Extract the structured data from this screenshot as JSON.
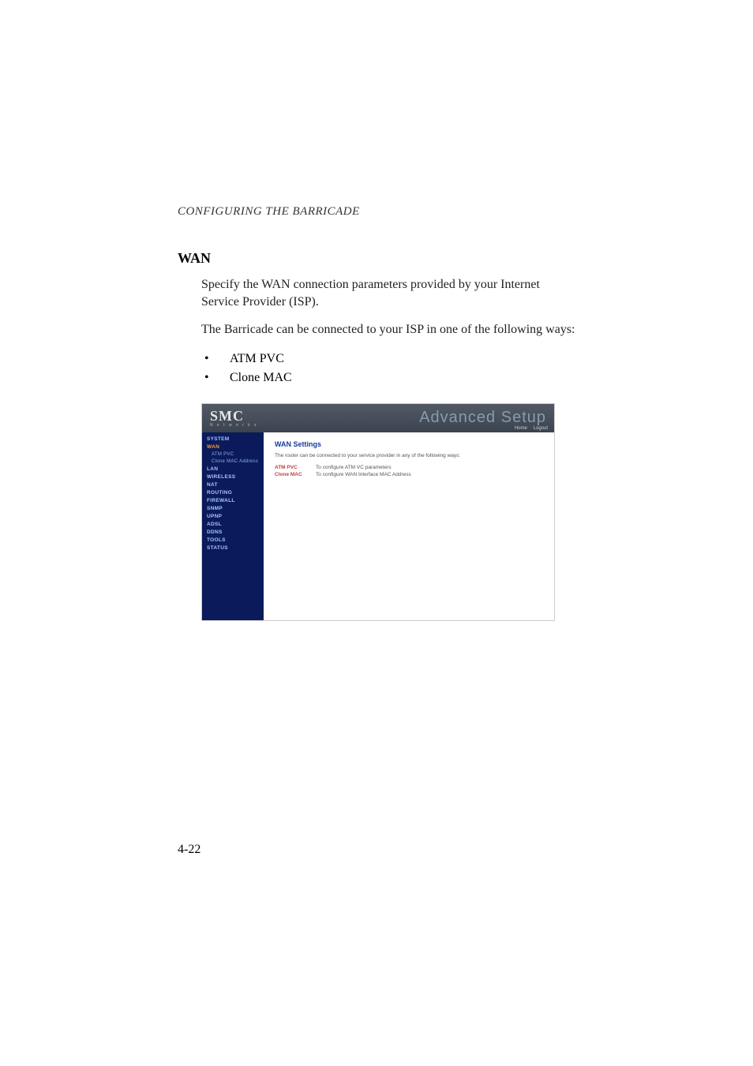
{
  "header": {
    "running": "CONFIGURING THE BARRICADE"
  },
  "section": {
    "title": "WAN",
    "para1": "Specify the WAN connection parameters provided by your Internet Service Provider (ISP).",
    "para2": "The Barricade can be connected to your ISP in one of the following ways:",
    "bullets": [
      "ATM PVC",
      "Clone MAC"
    ]
  },
  "screenshot": {
    "logo": "SMC",
    "logo_sub": "N e t w o r k s",
    "advanced": "Advanced Setup",
    "top_links": [
      "Home",
      "Logout"
    ],
    "nav": [
      {
        "label": "SYSTEM",
        "sub": false,
        "sel": false
      },
      {
        "label": "WAN",
        "sub": false,
        "sel": true
      },
      {
        "label": "ATM PVC",
        "sub": true,
        "sel": false
      },
      {
        "label": "Clone MAC Address",
        "sub": true,
        "sel": false
      },
      {
        "label": "LAN",
        "sub": false,
        "sel": false
      },
      {
        "label": "WIRELESS",
        "sub": false,
        "sel": false
      },
      {
        "label": "NAT",
        "sub": false,
        "sel": false
      },
      {
        "label": "ROUTING",
        "sub": false,
        "sel": false
      },
      {
        "label": "FIREWALL",
        "sub": false,
        "sel": false
      },
      {
        "label": "SNMP",
        "sub": false,
        "sel": false
      },
      {
        "label": "UPnP",
        "sub": false,
        "sel": false
      },
      {
        "label": "ADSL",
        "sub": false,
        "sel": false
      },
      {
        "label": "DDNS",
        "sub": false,
        "sel": false
      },
      {
        "label": "TOOLS",
        "sub": false,
        "sel": false
      },
      {
        "label": "STATUS",
        "sub": false,
        "sel": false
      }
    ],
    "content": {
      "title": "WAN Settings",
      "intro": "The router can be connected to your service provider in any of the following ways:",
      "rows": [
        {
          "label": "ATM PVC",
          "desc": "To configure ATM VC parameters"
        },
        {
          "label": "Clone MAC",
          "desc": "To configure WAN Interface MAC Address"
        }
      ]
    }
  },
  "page_number": "4-22"
}
